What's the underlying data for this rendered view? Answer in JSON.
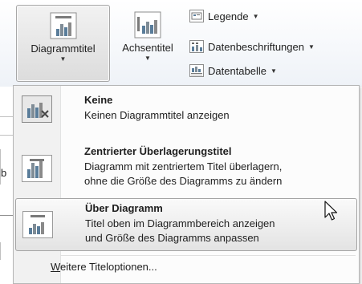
{
  "ribbon": {
    "chart_title_button": {
      "label": "Diagrammtitel"
    },
    "axis_titles_button": {
      "label": "Achsentitel"
    },
    "legend_button": {
      "label": "Legende"
    },
    "data_labels_button": {
      "label": "Datenbeschriftungen"
    },
    "data_table_button": {
      "label": "Datentabelle"
    }
  },
  "menu": {
    "items": [
      {
        "title": "Keine",
        "description_lines": [
          "Keinen Diagrammtitel anzeigen"
        ]
      },
      {
        "title": "Zentrierter Überlagerungstitel",
        "description_lines": [
          "Diagramm mit zentriertem Titel überlagern,",
          "ohne die Größe des Diagramms zu ändern"
        ]
      },
      {
        "title": "Über Diagramm",
        "description_lines": [
          "Titel oben im Diagrammbereich anzeigen",
          "und Größe des Diagramms anpassen"
        ]
      }
    ],
    "more_options": {
      "accelerator": "W",
      "rest": "eitere Titeloptionen..."
    }
  },
  "sheet_fragment": {
    "text": "b"
  }
}
